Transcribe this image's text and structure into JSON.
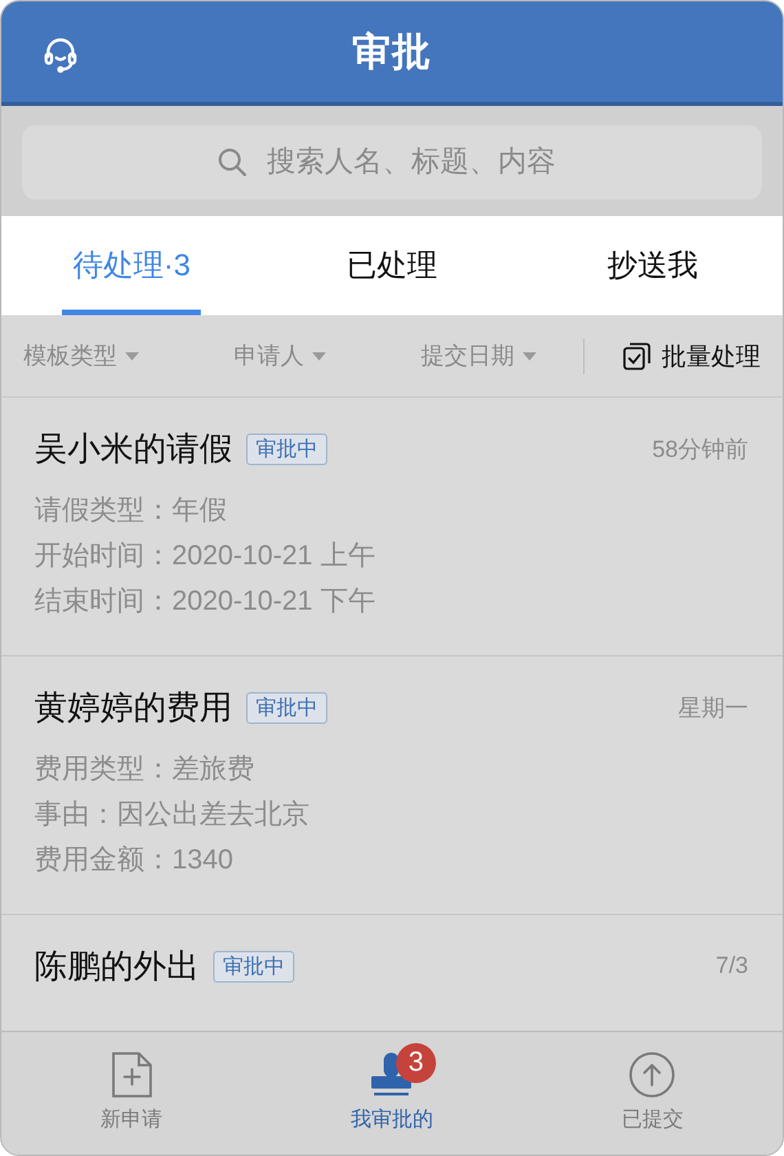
{
  "header": {
    "title": "审批"
  },
  "search": {
    "placeholder": "搜索人名、标题、内容"
  },
  "tabs": [
    {
      "label": "待处理·3",
      "selected": true
    },
    {
      "label": "已处理",
      "selected": false
    },
    {
      "label": "抄送我",
      "selected": false
    }
  ],
  "filters": [
    "模板类型",
    "申请人",
    "提交日期"
  ],
  "batch_button": "批量处理",
  "approvals": [
    {
      "title": "吴小米的请假",
      "status": "审批中",
      "time": "58分钟前",
      "fields": [
        "请假类型：年假",
        "开始时间：2020-10-21 上午",
        "结束时间：2020-10-21 下午"
      ]
    },
    {
      "title": "黄婷婷的费用",
      "status": "审批中",
      "time": "星期一",
      "fields": [
        "费用类型：差旅费",
        "事由：因公出差去北京",
        "费用金额：1340"
      ]
    },
    {
      "title": "陈鹏的外出",
      "status": "审批中",
      "time": "7/3"
    }
  ],
  "bottom_nav": [
    {
      "kind": "new",
      "label": "新申请",
      "selected": false
    },
    {
      "kind": "stamp",
      "label": "我审批的",
      "selected": true,
      "badge": "3"
    },
    {
      "kind": "upload",
      "label": "已提交",
      "selected": false
    }
  ]
}
